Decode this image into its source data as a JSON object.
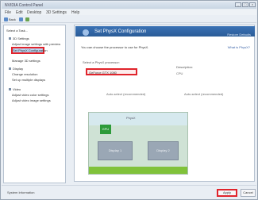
{
  "window": {
    "title": "NVIDIA Control Panel",
    "controls": [
      "_",
      "□",
      "×"
    ]
  },
  "menu": {
    "items": [
      "File",
      "Edit",
      "Desktop",
      "3D Settings",
      "Help"
    ]
  },
  "toolbar": {
    "back_label": "Back",
    "forward_label": "",
    "home_label": ""
  },
  "sidebar": {
    "items": [
      {
        "label": "Select a Task..."
      },
      {
        "label": "3D Settings"
      },
      {
        "label": "Adjust image settings with preview"
      },
      {
        "label": "Manage 3D settings"
      },
      {
        "label": "Set PhysX Configuration"
      },
      {
        "label": "Display"
      },
      {
        "label": "Change resolution"
      },
      {
        "label": "Set up multiple displays"
      },
      {
        "label": "Video"
      },
      {
        "label": "Adjust video color settings"
      },
      {
        "label": "Adjust video image settings"
      }
    ]
  },
  "panel": {
    "title": "Set PhysX Configuration",
    "help": "Restore Defaults",
    "description": "You can choose the processor to use for PhysX.",
    "link": "What is PhysX?",
    "section_label": "Select a PhysX processor:",
    "selected_processor": "GeForce GTX 1080",
    "right_label": "Description:",
    "note_1": "Auto-select (recommended)",
    "note_2": "CPU",
    "diagram_top_label": "PhysX",
    "diagram_node_label": "GPU",
    "screen1_label": "Display 1",
    "screen2_label": "Display 2"
  },
  "footer": {
    "status": "System Information",
    "apply_label": "Apply",
    "cancel_label": "Cancel"
  },
  "colors": {
    "highlight": "#e0242c",
    "header": "#2a5b97",
    "green": "#2d9b3a"
  }
}
